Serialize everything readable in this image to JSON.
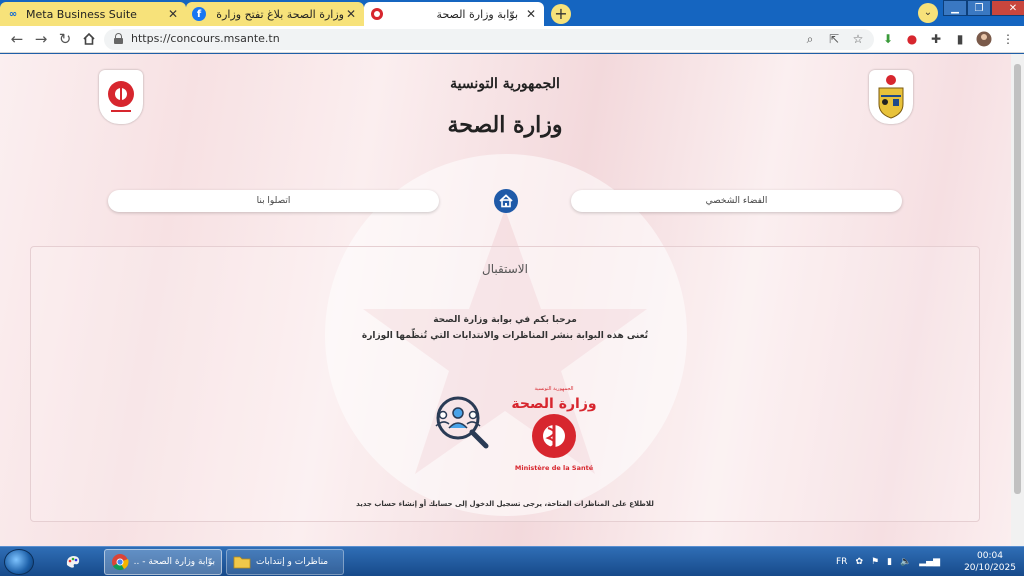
{
  "browser": {
    "tabs": [
      {
        "title": "Meta Business Suite",
        "close": "✕"
      },
      {
        "title": "وزارة الصحة بلاغ تفتح وزارة الصحة يوم ؟",
        "close": "✕"
      },
      {
        "title": "بوّابة وزارة الصحة",
        "close": "✕"
      }
    ],
    "new_tab": "+",
    "url": "https://concours.msante.tn"
  },
  "page": {
    "republic": "الجمهورية التونسية",
    "ministry": "وزارة الصحة",
    "nav": {
      "contact": "اتصلوا بنا",
      "personal_space": "الفضاء الشخصي"
    },
    "section_title": "الاستقبال",
    "welcome_line1": "مرحبا بكم في بوابة وزارة الصحة",
    "welcome_line2": "تُعنى هذه البوابة بنشر المناظرات والانتدابات التي تُنظّمها الوزارة",
    "ministry_logo_ar": "وزارة الصحة",
    "ministry_logo_fr": "Ministère de la Santé",
    "footer_note": "للاطلاع على المناظرات المتاحة، يرجى تسجيل الدخول إلى حسابك أو إنشاء حساب جديد"
  },
  "taskbar": {
    "chrome_label": "بوّابة وزارة الصحة - ...",
    "folder_label": "مناظرات و إنتدابات",
    "language": "FR",
    "time": "00:04",
    "date": "20/10/2025"
  },
  "colors": {
    "tab_strip": "#1565c0",
    "tab_yellow": "#f7e27a",
    "home_button": "#1f5aa8",
    "ministry_red": "#d7262e"
  },
  "icons": [
    "meta-icon",
    "facebook-icon",
    "ministry-favicon",
    "lock-icon",
    "home-icon",
    "star-icon",
    "extensions-icon"
  ]
}
